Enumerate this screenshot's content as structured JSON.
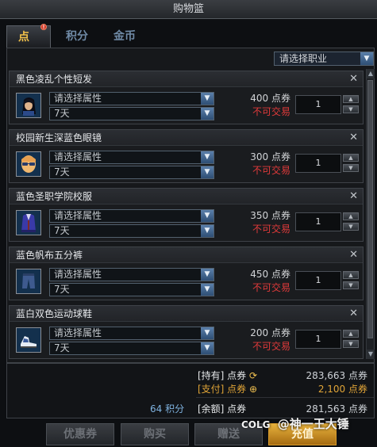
{
  "window": {
    "title": "购物篮"
  },
  "tabs": [
    {
      "label": "点券",
      "badge": "!"
    },
    {
      "label": "积分"
    },
    {
      "label": "金币"
    }
  ],
  "job_select": {
    "value": "请选择职业"
  },
  "items": [
    {
      "name": "黑色凌乱个性短发",
      "attr": "请选择属性",
      "duration": "7天",
      "price": "400 点券",
      "trade": "不可交易",
      "qty": "1",
      "icon": "hair-icon"
    },
    {
      "name": "校园新生深蓝色眼镜",
      "attr": "请选择属性",
      "duration": "7天",
      "price": "300 点券",
      "trade": "不可交易",
      "qty": "1",
      "icon": "glasses-icon"
    },
    {
      "name": "蓝色圣职学院校服",
      "attr": "请选择属性",
      "duration": "7天",
      "price": "350 点券",
      "trade": "不可交易",
      "qty": "1",
      "icon": "uniform-icon"
    },
    {
      "name": "蓝色帆布五分裤",
      "attr": "请选择属性",
      "duration": "7天",
      "price": "450 点券",
      "trade": "不可交易",
      "qty": "1",
      "icon": "pants-icon"
    },
    {
      "name": "蓝白双色运动球鞋",
      "attr": "请选择属性",
      "duration": "7天",
      "price": "200 点券",
      "trade": "不可交易",
      "qty": "1",
      "icon": "shoes-icon"
    }
  ],
  "summary": {
    "have_label": "[持有] 点券",
    "have_value": "283,663 点券",
    "pay_label": "[支付] 点券",
    "pay_value": "2,100 点券",
    "remain_label": "[余额] 点券",
    "remain_value": "281,563 点券",
    "points": "64 积分"
  },
  "buttons": {
    "coupon": "优惠券",
    "buy": "购买",
    "gift": "赠送",
    "recharge": "充值"
  },
  "watermark": {
    "logo": "COLG",
    "text": "@神一王大锤"
  },
  "colors": {
    "accent": "#f2c14a",
    "warning": "#e03a3a",
    "primary_button": "#e8b23c"
  }
}
